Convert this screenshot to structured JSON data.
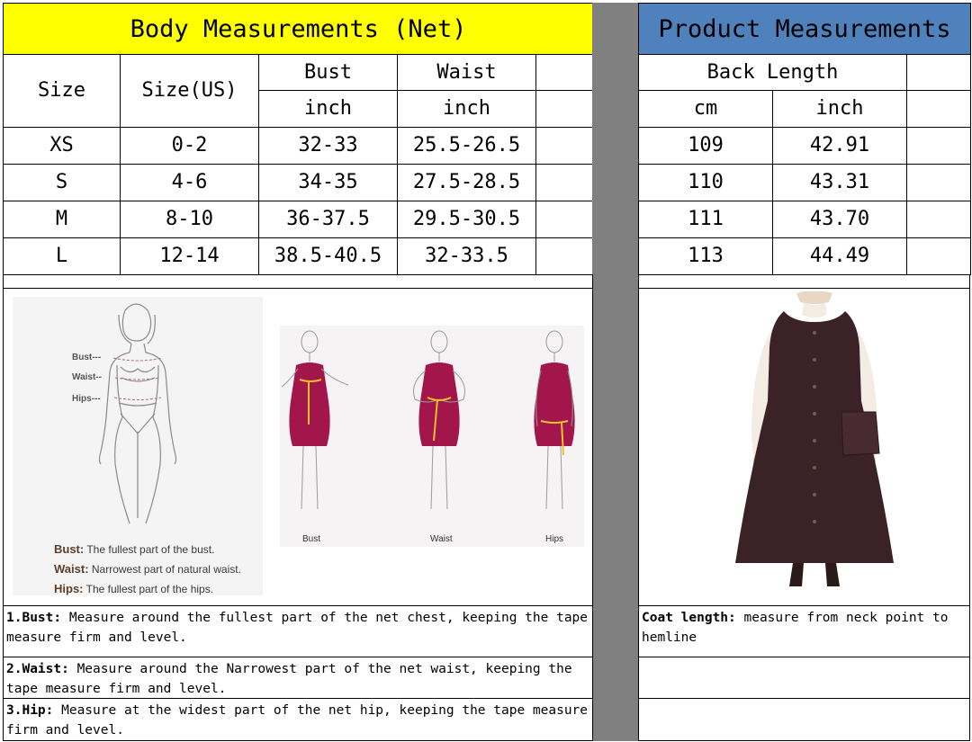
{
  "body_table": {
    "title": "Body Measurements (Net)",
    "col_size": "Size",
    "col_size_us": "Size(US)",
    "col_bust": "Bust",
    "col_waist": "Waist",
    "unit_bust": "inch",
    "unit_waist": "inch",
    "rows": [
      {
        "size": "XS",
        "us": "0-2",
        "bust": "32-33",
        "waist": "25.5-26.5"
      },
      {
        "size": "S",
        "us": "4-6",
        "bust": "34-35",
        "waist": "27.5-28.5"
      },
      {
        "size": "M",
        "us": "8-10",
        "bust": "36-37.5",
        "waist": "29.5-30.5"
      },
      {
        "size": "L",
        "us": "12-14",
        "bust": "38.5-40.5",
        "waist": "32-33.5"
      }
    ]
  },
  "product_table": {
    "title": "Product Measurements",
    "col_back_length": "Back Length",
    "unit_cm": "cm",
    "unit_inch": "inch",
    "rows": [
      {
        "cm": "109",
        "inch": "42.91"
      },
      {
        "cm": "110",
        "inch": "43.31"
      },
      {
        "cm": "111",
        "inch": "43.70"
      },
      {
        "cm": "113",
        "inch": "44.49"
      }
    ]
  },
  "figure_left": {
    "mark_bust": "Bust---",
    "mark_waist": "Waist--",
    "mark_hips": "Hips---",
    "legend": [
      {
        "term": "Bust:",
        "text": "The fullest part of the bust."
      },
      {
        "term": "Waist:",
        "text": "Narrowest part of natural waist."
      },
      {
        "term": "Hips:",
        "text": "The fullest part of the hips."
      }
    ]
  },
  "figure_mid": {
    "captions": [
      "Bust",
      "Waist",
      "Hips"
    ]
  },
  "notes": [
    {
      "term": "1.Bust:",
      "text": " Measure around the fullest part of the net chest, keeping the tape  measure firm and level."
    },
    {
      "term": "2.Waist:",
      "text": " Measure around the Narrowest part of the net waist, keeping the tape  measure firm and level."
    },
    {
      "term": "3.Hip:",
      "text": " Measure at the widest part of the net hip, keeping the tape measure firm and level."
    }
  ],
  "product_note": {
    "term": "Coat length:",
    "text": " measure from neck point to hemline"
  },
  "colors": {
    "title_yellow": "#FFFF00",
    "title_blue": "#4F81BD",
    "divider_gray": "#808080",
    "dress_magenta": "#A3164B",
    "tape_yellow": "#F2C12E",
    "pinafore_brown": "#3A2226"
  }
}
